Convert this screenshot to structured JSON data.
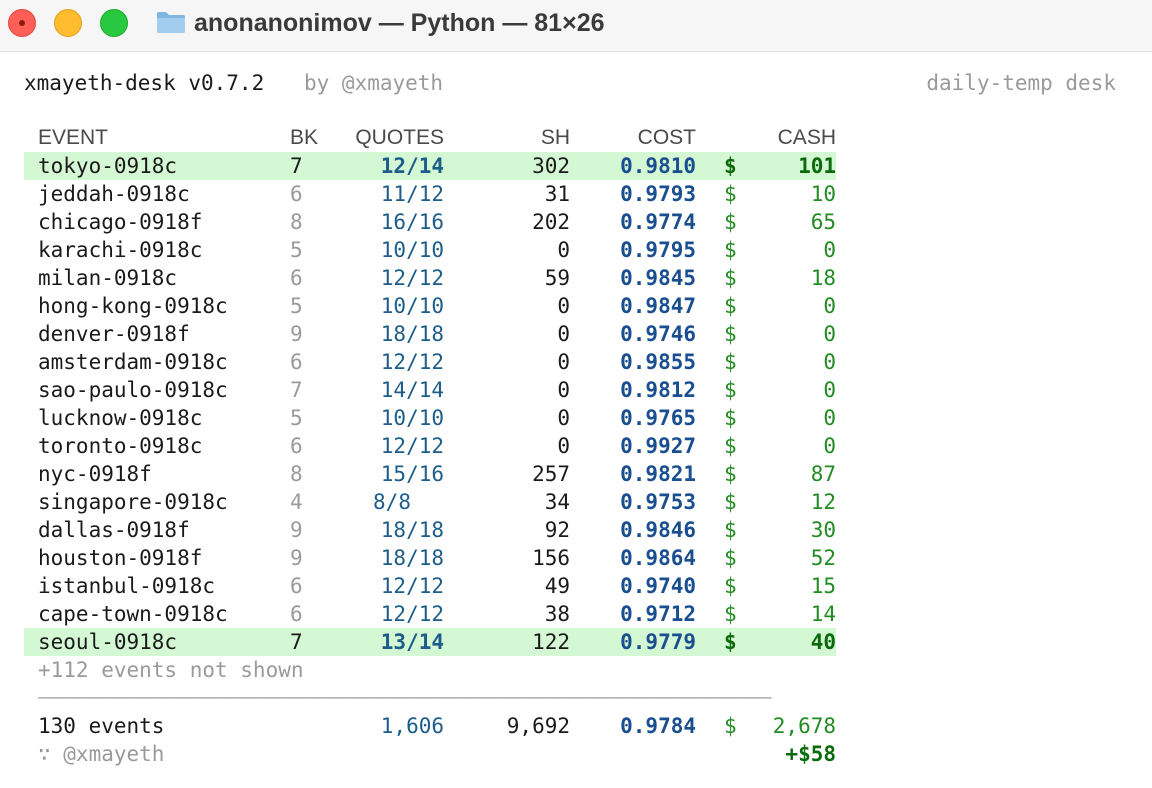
{
  "window": {
    "title": "anonanonimov — Python — 81×26",
    "buttons": [
      "close",
      "minimize",
      "zoom"
    ],
    "icon": "folder-icon"
  },
  "app": {
    "name": "xmayeth-desk v0.7.2",
    "by": "by @xmayeth",
    "mode": "daily-temp desk"
  },
  "table": {
    "headers": {
      "event": "EVENT",
      "bk": "BK",
      "quotes": "QUOTES",
      "sh": "SH",
      "cost": "COST",
      "cash": "CASH"
    },
    "currency": "$",
    "rows": [
      {
        "event": "tokyo-0918c",
        "bk": "7",
        "quotes": "12/14",
        "sh": "302",
        "cost": "0.9810",
        "cash": "101",
        "highlight": true
      },
      {
        "event": "jeddah-0918c",
        "bk": "6",
        "quotes": "11/12",
        "sh": "31",
        "cost": "0.9793",
        "cash": "10",
        "highlight": false
      },
      {
        "event": "chicago-0918f",
        "bk": "8",
        "quotes": "16/16",
        "sh": "202",
        "cost": "0.9774",
        "cash": "65",
        "highlight": false
      },
      {
        "event": "karachi-0918c",
        "bk": "5",
        "quotes": "10/10",
        "sh": "0",
        "cost": "0.9795",
        "cash": "0",
        "highlight": false
      },
      {
        "event": "milan-0918c",
        "bk": "6",
        "quotes": "12/12",
        "sh": "59",
        "cost": "0.9845",
        "cash": "18",
        "highlight": false
      },
      {
        "event": "hong-kong-0918c",
        "bk": "5",
        "quotes": "10/10",
        "sh": "0",
        "cost": "0.9847",
        "cash": "0",
        "highlight": false
      },
      {
        "event": "denver-0918f",
        "bk": "9",
        "quotes": "18/18",
        "sh": "0",
        "cost": "0.9746",
        "cash": "0",
        "highlight": false
      },
      {
        "event": "amsterdam-0918c",
        "bk": "6",
        "quotes": "12/12",
        "sh": "0",
        "cost": "0.9855",
        "cash": "0",
        "highlight": false
      },
      {
        "event": "sao-paulo-0918c",
        "bk": "7",
        "quotes": "14/14",
        "sh": "0",
        "cost": "0.9812",
        "cash": "0",
        "highlight": false
      },
      {
        "event": "lucknow-0918c",
        "bk": "5",
        "quotes": "10/10",
        "sh": "0",
        "cost": "0.9765",
        "cash": "0",
        "highlight": false
      },
      {
        "event": "toronto-0918c",
        "bk": "6",
        "quotes": "12/12",
        "sh": "0",
        "cost": "0.9927",
        "cash": "0",
        "highlight": false
      },
      {
        "event": "nyc-0918f",
        "bk": "8",
        "quotes": "15/16",
        "sh": "257",
        "cost": "0.9821",
        "cash": "87",
        "highlight": false
      },
      {
        "event": "singapore-0918c",
        "bk": "4",
        "quotes": "8/8",
        "sh": "34",
        "cost": "0.9753",
        "cash": "12",
        "highlight": false
      },
      {
        "event": "dallas-0918f",
        "bk": "9",
        "quotes": "18/18",
        "sh": "92",
        "cost": "0.9846",
        "cash": "30",
        "highlight": false
      },
      {
        "event": "houston-0918f",
        "bk": "9",
        "quotes": "18/18",
        "sh": "156",
        "cost": "0.9864",
        "cash": "52",
        "highlight": false
      },
      {
        "event": "istanbul-0918c",
        "bk": "6",
        "quotes": "12/12",
        "sh": "49",
        "cost": "0.9740",
        "cash": "15",
        "highlight": false
      },
      {
        "event": "cape-town-0918c",
        "bk": "6",
        "quotes": "12/12",
        "sh": "38",
        "cost": "0.9712",
        "cash": "14",
        "highlight": false
      },
      {
        "event": "seoul-0918c",
        "bk": "7",
        "quotes": "13/14",
        "sh": "122",
        "cost": "0.9779",
        "cash": "40",
        "highlight": true
      }
    ],
    "more": "+112 events not shown",
    "separator": "──────────────────────────────────────────────────────────",
    "totals": {
      "events": "130 events",
      "quotes": "1,606",
      "sh": "9,692",
      "cost": "0.9784",
      "cash": "2,678"
    },
    "footer": {
      "handle": "∵ @xmayeth",
      "pnl": "+$58"
    }
  }
}
